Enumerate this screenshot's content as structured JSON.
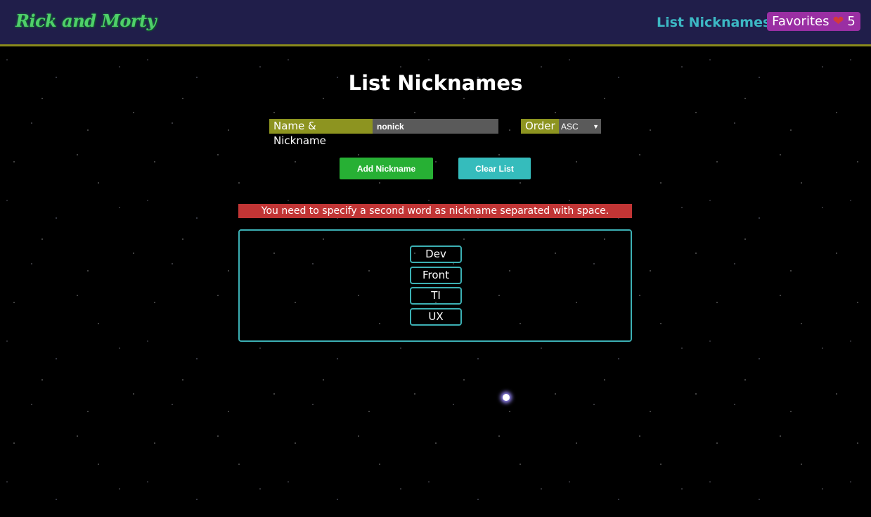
{
  "header": {
    "logo_text": "Rick and Morty",
    "nav_link": "List Nicknames",
    "favorites_label": "Favorites",
    "favorites_count": "5"
  },
  "main": {
    "title": "List Nicknames",
    "name_label": "Name & Nickname",
    "name_value": "nonick",
    "order_label": "Order",
    "order_selected": "ASC",
    "add_button": "Add Nickname",
    "clear_button": "Clear List",
    "error_message": "You need to specify a second word as nickname separated with space.",
    "nicknames": [
      "Dev",
      "Front",
      "TI",
      "UX"
    ]
  },
  "colors": {
    "header_bg": "#201e4a",
    "label_bg": "#8d9420",
    "add_button": "#27b034",
    "clear_button": "#35bcbc",
    "error_bg": "#c13535",
    "accent": "#3cb0b4",
    "favorites_bg": "#9a2fa3"
  }
}
